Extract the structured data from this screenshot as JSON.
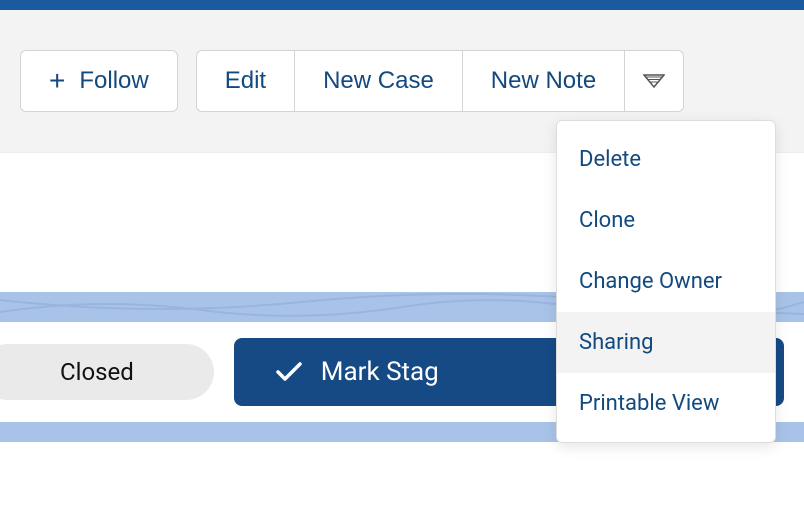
{
  "toolbar": {
    "follow_label": "Follow",
    "edit_label": "Edit",
    "new_case_label": "New Case",
    "new_note_label": "New Note"
  },
  "stage": {
    "closed_label": "Closed",
    "mark_label": "Mark Stag"
  },
  "dropdown": {
    "items": [
      {
        "label": "Delete"
      },
      {
        "label": "Clone"
      },
      {
        "label": "Change Owner"
      },
      {
        "label": "Sharing"
      },
      {
        "label": "Printable View"
      }
    ],
    "hover_index": 3
  }
}
